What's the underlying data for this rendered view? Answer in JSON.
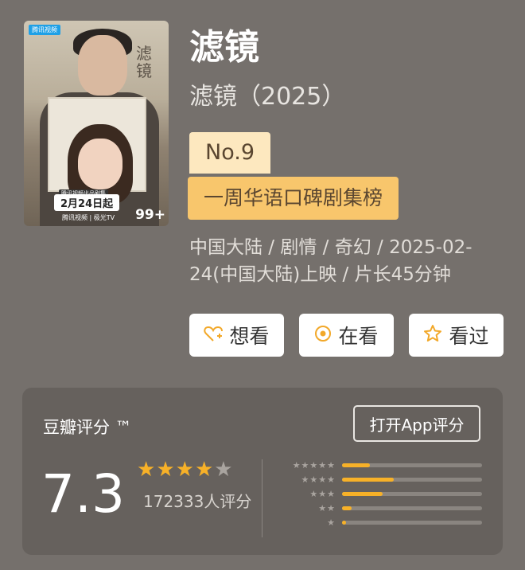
{
  "poster": {
    "platform_badge": "腾讯视频",
    "title_vertical": "滤镜",
    "credit": "腾讯视频出品剧集",
    "air_date": "2月24日起",
    "platforms": "腾讯视频 | 极光TV",
    "count": "99+"
  },
  "title": "滤镜",
  "subtitle": "滤镜（2025）",
  "ranking": {
    "number": "No.9",
    "list_name": "一周华语口碑剧集榜"
  },
  "meta": "中国大陆 / 剧情 / 奇幻 / 2025-02-24(中国大陆)上映 / 片长45分钟",
  "actions": [
    {
      "label": "想看",
      "icon": "heart-plus-icon"
    },
    {
      "label": "在看",
      "icon": "target-icon"
    },
    {
      "label": "看过",
      "icon": "star-outline-icon"
    }
  ],
  "rating": {
    "label": "豆瓣评分 ™",
    "open_app": "打开App评分",
    "score": "7.3",
    "stars_filled": 3.5,
    "stars_total": 5,
    "votes": "172333人评分",
    "distribution": [
      {
        "stars": 5,
        "fraction": 0.2
      },
      {
        "stars": 4,
        "fraction": 0.37
      },
      {
        "stars": 3,
        "fraction": 0.29
      },
      {
        "stars": 2,
        "fraction": 0.07
      },
      {
        "stars": 1,
        "fraction": 0.03
      }
    ]
  },
  "colors": {
    "background": "#75706c",
    "card": "#66615d",
    "accent_star": "#f7b128",
    "rank_no_bg": "#fde8bf",
    "rank_name_bg": "#f8c66c"
  }
}
